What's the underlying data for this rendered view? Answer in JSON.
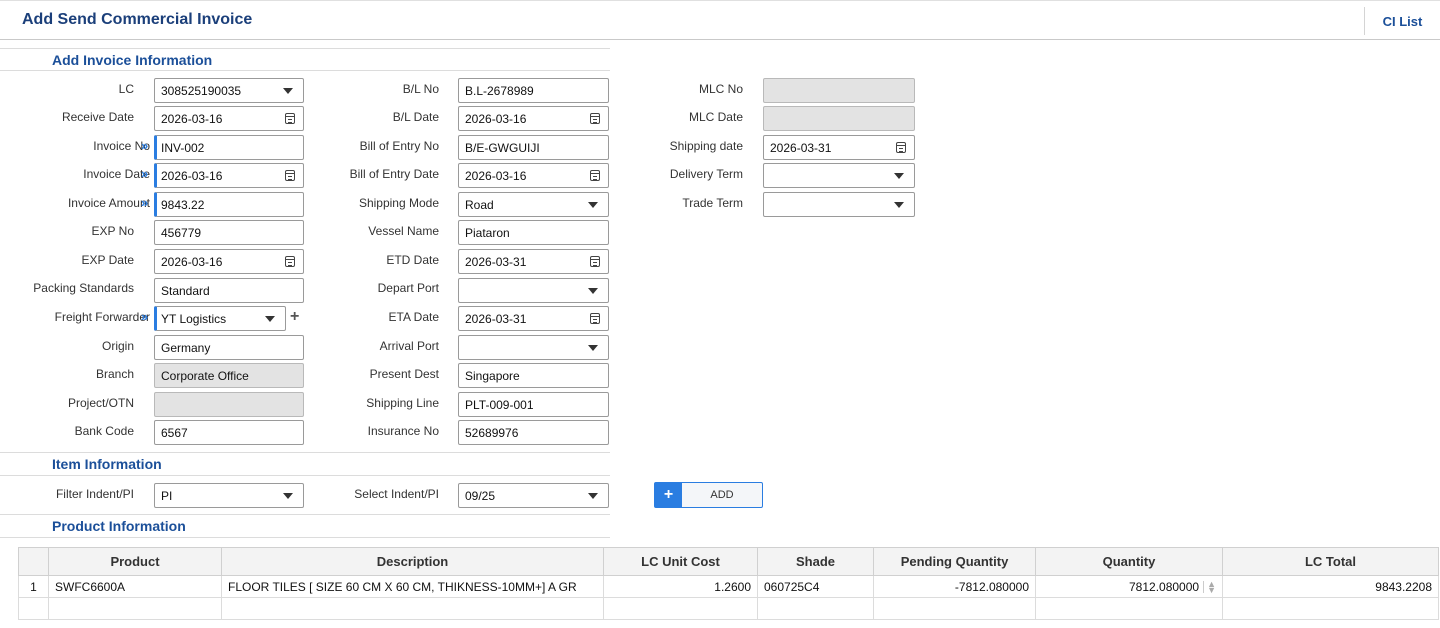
{
  "header": {
    "title": "Add Send Commercial Invoice",
    "ci_list": "CI List"
  },
  "sections": {
    "invoice": "Add Invoice Information",
    "item": "Item Information",
    "product": "Product Information"
  },
  "form": {
    "lc": {
      "label": "LC",
      "value": "308525190035"
    },
    "receive_date": {
      "label": "Receive Date",
      "value": "2026-03-16"
    },
    "invoice_no": {
      "label": "Invoice No",
      "value": "INV-002"
    },
    "invoice_date": {
      "label": "Invoice Date",
      "value": "2026-03-16"
    },
    "invoice_amount": {
      "label": "Invoice Amount",
      "value": "9843.22"
    },
    "exp_no": {
      "label": "EXP No",
      "value": "456779"
    },
    "exp_date": {
      "label": "EXP Date",
      "value": "2026-03-16"
    },
    "packing_standards": {
      "label": "Packing Standards",
      "value": "Standard"
    },
    "freight_forwarder": {
      "label": "Freight Forwarder",
      "value": "YT Logistics"
    },
    "origin": {
      "label": "Origin",
      "value": "Germany"
    },
    "branch": {
      "label": "Branch",
      "value": "Corporate Office"
    },
    "project_otn": {
      "label": "Project/OTN",
      "value": ""
    },
    "bank_code": {
      "label": "Bank Code",
      "value": "6567"
    },
    "bl_no": {
      "label": "B/L No",
      "value": "B.L-2678989"
    },
    "bl_date": {
      "label": "B/L Date",
      "value": "2026-03-16"
    },
    "bill_of_entry_no": {
      "label": "Bill of Entry No",
      "value": "B/E-GWGUIJI"
    },
    "bill_of_entry_date": {
      "label": "Bill of Entry Date",
      "value": "2026-03-16"
    },
    "shipping_mode": {
      "label": "Shipping Mode",
      "value": "Road"
    },
    "vessel_name": {
      "label": "Vessel Name",
      "value": "Piataron"
    },
    "etd_date": {
      "label": "ETD Date",
      "value": "2026-03-31"
    },
    "depart_port": {
      "label": "Depart Port",
      "value": ""
    },
    "eta_date": {
      "label": "ETA Date",
      "value": "2026-03-31"
    },
    "arrival_port": {
      "label": "Arrival Port",
      "value": ""
    },
    "present_dest": {
      "label": "Present Dest",
      "value": "Singapore"
    },
    "shipping_line": {
      "label": "Shipping Line",
      "value": "PLT-009-001"
    },
    "insurance_no": {
      "label": "Insurance No",
      "value": "52689976"
    },
    "mlc_no": {
      "label": "MLC No",
      "value": ""
    },
    "mlc_date": {
      "label": "MLC Date",
      "value": ""
    },
    "shipping_date": {
      "label": "Shipping date",
      "value": "2026-03-31"
    },
    "delivery_term": {
      "label": "Delivery Term",
      "value": ""
    },
    "trade_term": {
      "label": "Trade Term",
      "value": ""
    },
    "required_marker": "»"
  },
  "item": {
    "filter": {
      "label": "Filter Indent/PI",
      "value": "PI"
    },
    "select": {
      "label": "Select Indent/PI",
      "value": "09/25"
    },
    "add_plus": "+",
    "add_label": "ADD",
    "forwarder_plus": "+"
  },
  "product_table": {
    "columns": [
      "",
      "Product",
      "Description",
      "LC Unit Cost",
      "Shade",
      "Pending Quantity",
      "Quantity",
      "LC Total"
    ],
    "rows": [
      {
        "index": "1",
        "product": "SWFC6600A",
        "description": "FLOOR TILES [ SIZE 60 CM X 60 CM, THIKNESS-10MM+] A GR",
        "unit_cost": "1.2600",
        "shade": "060725C4",
        "pending_quantity": "-7812.080000",
        "quantity": "7812.080000",
        "lc_total": "9843.2208"
      }
    ]
  }
}
